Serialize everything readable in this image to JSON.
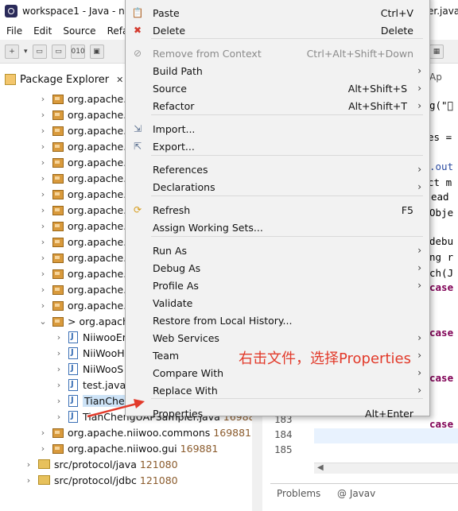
{
  "window": {
    "title": "workspace1 - Java - n",
    "title_right": "er.java"
  },
  "menubar": [
    "File",
    "Edit",
    "Source",
    "Refa"
  ],
  "package_explorer": {
    "tab_label": "Package Explorer",
    "close": "✕",
    "rows": [
      {
        "kind": "pkg",
        "label": "org.apache."
      },
      {
        "kind": "pkg",
        "label": "org.apache."
      },
      {
        "kind": "pkg",
        "label": "org.apache."
      },
      {
        "kind": "pkg",
        "label": "org.apache."
      },
      {
        "kind": "pkg",
        "label": "org.apache."
      },
      {
        "kind": "pkg",
        "label": "org.apache."
      },
      {
        "kind": "pkg",
        "label": "org.apache."
      },
      {
        "kind": "pkg",
        "label": "org.apache."
      },
      {
        "kind": "pkg",
        "label": "org.apache."
      },
      {
        "kind": "pkg",
        "label": "org.apache."
      },
      {
        "kind": "pkg",
        "label": "org.apache."
      },
      {
        "kind": "pkg",
        "label": "org.apache."
      },
      {
        "kind": "pkg",
        "label": "org.apache."
      },
      {
        "kind": "pkg",
        "label": "org.apache."
      },
      {
        "kind": "pkg-open",
        "label": "> org.apach"
      },
      {
        "kind": "java",
        "label": "NiiwooEr"
      },
      {
        "kind": "java",
        "label": "NiiWooH"
      },
      {
        "kind": "java",
        "label": "NiiWooS"
      },
      {
        "kind": "java",
        "label": "test.java"
      },
      {
        "kind": "java-sel",
        "label": "TianChengSampler.java",
        "version": "169881"
      },
      {
        "kind": "java",
        "label": "TianChengUAPSampler.java",
        "version": "169881"
      },
      {
        "kind": "pkg",
        "label": "org.apache.niiwoo.commons",
        "version": "169881"
      },
      {
        "kind": "pkg",
        "label": "org.apache.niiwoo.gui",
        "version": "169881"
      },
      {
        "kind": "folder",
        "label": "src/protocol/java",
        "version": "121080"
      },
      {
        "kind": "folder",
        "label": "src/protocol/jdbc",
        "version": "121080"
      }
    ]
  },
  "editor": {
    "tab_right": "Ap",
    "code_lines": [
      {
        "text": "g(\"\u0000",
        "cls": ""
      },
      {
        "text": "es =",
        "cls": ""
      },
      {
        "text": ".out",
        "cls": "blue"
      },
      {
        "text": "ct m",
        "cls": ""
      },
      {
        "text": "ead",
        "cls": ""
      },
      {
        "text": "Obje",
        "cls": ""
      },
      {
        "text": "debu",
        "cls": ""
      },
      {
        "text": "ng r",
        "cls": ""
      },
      {
        "text": "ch(J",
        "cls": ""
      },
      {
        "text": "case",
        "cls": "kw"
      },
      {
        "text": "case",
        "cls": "kw"
      },
      {
        "text": "case",
        "cls": "kw"
      },
      {
        "text": "case",
        "cls": "kw"
      }
    ],
    "line_numbers": [
      "183",
      "184",
      "185"
    ]
  },
  "problems": {
    "tab1": "Problems",
    "tab2": "@ Javav"
  },
  "context_menu": {
    "items": [
      {
        "label": "Paste",
        "shortcut": "Ctrl+V",
        "icon": "paste-icon",
        "glyph": "📋"
      },
      {
        "label": "Delete",
        "shortcut": "Delete",
        "icon": "delete-icon",
        "glyph": "✖"
      },
      {
        "label": "Remove from Context",
        "shortcut": "Ctrl+Alt+Shift+Down",
        "icon": "remove-context-icon",
        "glyph": "⊘",
        "disabled": true
      },
      {
        "label": "Build Path",
        "submenu": true
      },
      {
        "label": "Source",
        "shortcut": "Alt+Shift+S",
        "submenu": true
      },
      {
        "label": "Refactor",
        "shortcut": "Alt+Shift+T",
        "submenu": true
      },
      {
        "label": "Import...",
        "icon": "import-icon",
        "glyph": "⇲"
      },
      {
        "label": "Export...",
        "icon": "export-icon",
        "glyph": "⇱"
      },
      {
        "label": "References",
        "submenu": true
      },
      {
        "label": "Declarations",
        "submenu": true
      },
      {
        "label": "Refresh",
        "shortcut": "F5",
        "icon": "refresh-icon",
        "glyph": "⟳"
      },
      {
        "label": "Assign Working Sets..."
      },
      {
        "label": "Run As",
        "submenu": true
      },
      {
        "label": "Debug As",
        "submenu": true
      },
      {
        "label": "Profile As",
        "submenu": true
      },
      {
        "label": "Validate"
      },
      {
        "label": "Restore from Local History..."
      },
      {
        "label": "Web Services",
        "submenu": true
      },
      {
        "label": "Team",
        "submenu": true
      },
      {
        "label": "Compare With",
        "submenu": true
      },
      {
        "label": "Replace With",
        "submenu": true
      },
      {
        "label": "Properties",
        "shortcut": "Alt+Enter"
      }
    ]
  },
  "annotation": "右击文件，选择Properties",
  "colors": {
    "annotation": "#e23a2a",
    "menu_bg": "#f2f2f2"
  }
}
